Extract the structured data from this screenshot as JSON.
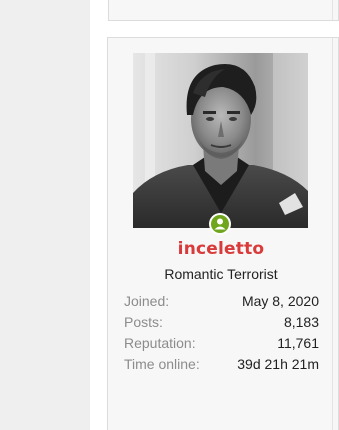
{
  "user": {
    "username": "inceletto",
    "title": "Romantic Terrorist",
    "online_status": "online"
  },
  "stats": [
    {
      "label": "Joined:",
      "value": "May 8, 2020"
    },
    {
      "label": "Posts:",
      "value": "8,183"
    },
    {
      "label": "Reputation:",
      "value": "11,761"
    },
    {
      "label": "Time online:",
      "value": "39d 21h 21m"
    }
  ],
  "colors": {
    "username": "#d93a3a",
    "online": "#6fa61e",
    "label": "#8c8c8c",
    "card_bg": "#f7f7f7"
  }
}
